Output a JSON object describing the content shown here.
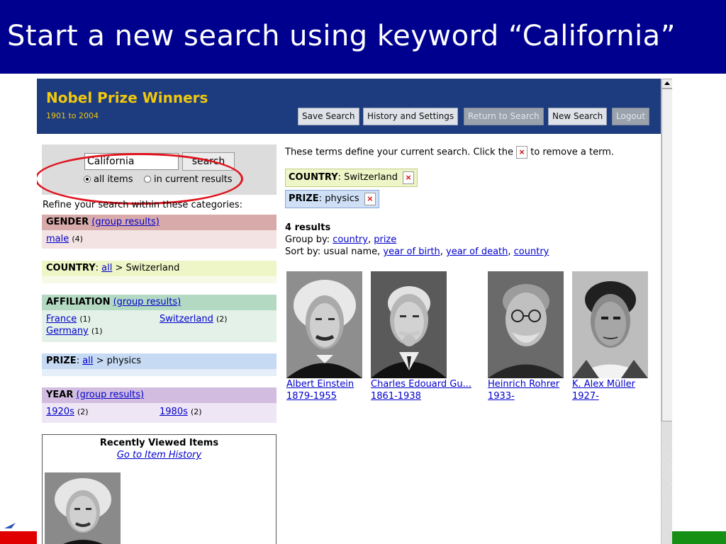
{
  "slide": {
    "title": "Start a new search using keyword “California”"
  },
  "app": {
    "title": "Nobel Prize Winners",
    "subtitle": "1901 to 2004",
    "nav": {
      "save_search": "Save Search",
      "history_settings": "History and Settings",
      "return_to_search": "Return to Search",
      "new_search": "New Search",
      "logout": "Logout"
    }
  },
  "search": {
    "value": "California",
    "button": "search",
    "scope_all": "all items",
    "scope_current": "in current results",
    "selected_scope": "all items"
  },
  "refine": {
    "label": "Refine your search within these categories:",
    "gender": {
      "title": "GENDER",
      "group_link": "(group results)",
      "items": [
        {
          "label": "male",
          "count": "(4)"
        }
      ]
    },
    "country": {
      "title": "COUNTRY",
      "sep": ":",
      "all": "all",
      "trail": "> Switzerland"
    },
    "affiliation": {
      "title": "AFFILIATION",
      "group_link": "(group results)",
      "items": [
        {
          "label": "France",
          "count": "(1)"
        },
        {
          "label": "Switzerland",
          "count": "(2)"
        },
        {
          "label": "Germany",
          "count": "(1)"
        }
      ]
    },
    "prize": {
      "title": "PRIZE",
      "sep": ":",
      "all": "all",
      "trail": "> physics"
    },
    "year": {
      "title": "YEAR",
      "group_link": "(group results)",
      "items": [
        {
          "label": "1920s",
          "count": "(2)"
        },
        {
          "label": "1980s",
          "count": "(2)"
        }
      ]
    }
  },
  "recent": {
    "title": "Recently Viewed Items",
    "link": "Go to Item History"
  },
  "terms": {
    "note_before": "These terms define your current search. Click the",
    "note_x": "×",
    "note_after": "to remove a term.",
    "country_label": "COUNTRY",
    "country_value": ": Switzerland",
    "prize_label": "PRIZE",
    "prize_value": ": physics",
    "remove": "×"
  },
  "results": {
    "count": "4 results",
    "group_by_label": "Group by:",
    "group_by": [
      "country",
      "prize"
    ],
    "sort_by_label": "Sort by: usual name,",
    "sort_by": [
      "year of birth",
      "year of death",
      "country"
    ],
    "people": [
      {
        "name": "Albert Einstein",
        "years": "1879-1955"
      },
      {
        "name": "Charles Edouard Gu...",
        "years": "1861-1938"
      },
      {
        "name": "Heinrich Rohrer",
        "years": "1933-"
      },
      {
        "name": "K. Alex Müller",
        "years": "1927-"
      }
    ]
  }
}
